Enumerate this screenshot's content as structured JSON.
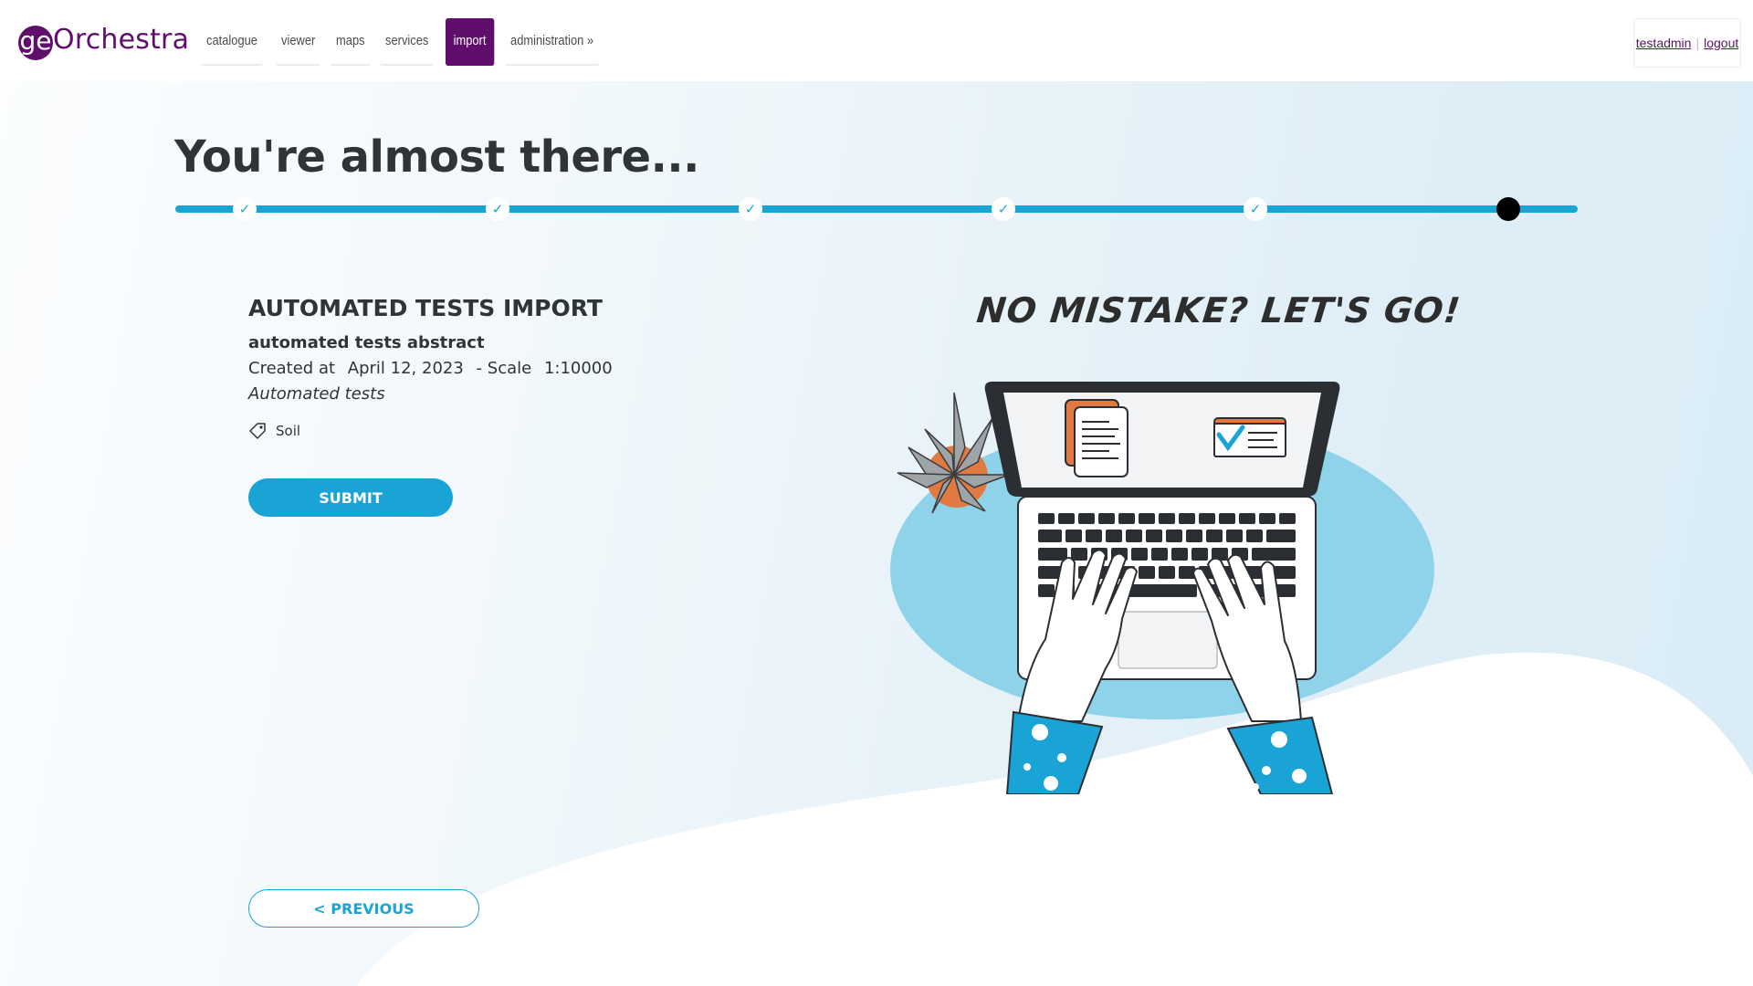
{
  "header": {
    "logo_mark": "ge",
    "logo_text": "Orchestra",
    "nav": [
      {
        "label": "catalogue"
      },
      {
        "label": "viewer"
      },
      {
        "label": "maps"
      },
      {
        "label": "services"
      },
      {
        "label": "import"
      },
      {
        "label": "administration »"
      }
    ],
    "active_nav": "import",
    "user": {
      "name": "testadmin",
      "separator": "|",
      "logout": "logout"
    }
  },
  "page": {
    "title": "You're almost there...",
    "progress": {
      "total_steps": 6,
      "completed_steps": 5,
      "current_step": 6
    }
  },
  "summary": {
    "title": "AUTOMATED TESTS IMPORT",
    "abstract": "automated tests abstract",
    "created_label": "Created at",
    "created_date": "April 12, 2023",
    "scale_label": "- Scale",
    "scale_value": "1:10000",
    "lineage": "Automated tests",
    "keyword": "Soil"
  },
  "actions": {
    "submit_label": "SUBMIT",
    "previous_label": "< PREVIOUS"
  },
  "illustration": {
    "tagline": "NO MISTAKE? LET'S GO!",
    "tagline_source": "handwritten illustration lettering"
  },
  "colors": {
    "brand": "#5f0f6b",
    "accent": "#1aa4d6",
    "text": "#2f3437",
    "illustration_blue": "#8ed3ea"
  }
}
